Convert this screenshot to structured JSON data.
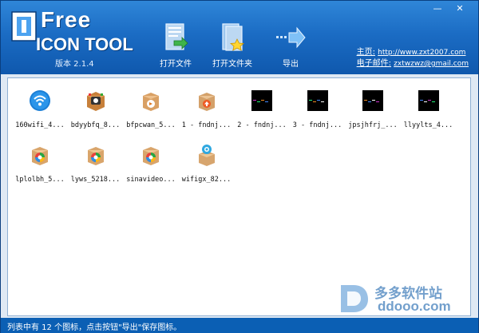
{
  "app": {
    "logo_free": "Free",
    "logo_name": "ICON TOOL",
    "version": "版本 2.1.4"
  },
  "window_controls": {
    "minimize": "—",
    "close": "✕"
  },
  "toolbar": {
    "open_file": {
      "label": "打开文件",
      "icon": "open-file-icon"
    },
    "open_folder": {
      "label": "打开文件夹",
      "icon": "open-folder-icon"
    },
    "export": {
      "label": "导出",
      "icon": "export-arrow-icon"
    }
  },
  "links": {
    "home_label": "主页:",
    "home_url": "http://www.zxt2007.com",
    "email_label": "电子邮件:",
    "email": "zxtwzwz@gmail.com"
  },
  "icons": [
    {
      "name": "160wifi_4...",
      "icon": "wifi-icon"
    },
    {
      "name": "bdyybfq_8...",
      "icon": "video-player-box-icon"
    },
    {
      "name": "bfpcwan_5...",
      "icon": "box-package-icon"
    },
    {
      "name": "1 - fndnj...",
      "icon": "box-upload-icon"
    },
    {
      "name": "2 - fndnj...",
      "icon": "black-thumbnail"
    },
    {
      "name": "3 - fndnj...",
      "icon": "black-thumbnail"
    },
    {
      "name": "jpsjhfrj_...",
      "icon": "black-thumbnail"
    },
    {
      "name": "llyylts_4...",
      "icon": "black-thumbnail"
    },
    {
      "name": "lplolbh_5...",
      "icon": "colorful-box-icon"
    },
    {
      "name": "lyws_5218...",
      "icon": "colorful-box-icon"
    },
    {
      "name": "sinavideo...",
      "icon": "colorful-box-icon"
    },
    {
      "name": "wifigx_82...",
      "icon": "wifi-box-icon"
    }
  ],
  "status": {
    "text": "列表中有 12 个图标，点击按钮\"导出\"保存图标。"
  },
  "watermark": {
    "cn": "多多软件站",
    "url": "ddooo.com"
  },
  "colors": {
    "header": "#1b6cc4",
    "status_bar": "#0b5fb4",
    "panel_bg": "#ffffff"
  }
}
